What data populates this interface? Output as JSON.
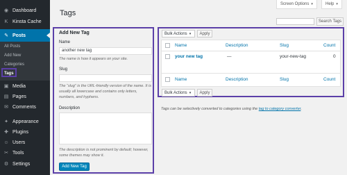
{
  "sidebar": {
    "items": [
      {
        "icon": "dashboard-icon",
        "glyph": "◉",
        "label": "Dashboard"
      },
      {
        "icon": "kinsta-icon",
        "glyph": "K",
        "label": "Kinsta Cache"
      },
      {
        "icon": "pin-icon",
        "glyph": "✎",
        "label": "Posts"
      },
      {
        "icon": "media-icon",
        "glyph": "▣",
        "label": "Media"
      },
      {
        "icon": "pages-icon",
        "glyph": "▤",
        "label": "Pages"
      },
      {
        "icon": "comments-icon",
        "glyph": "✉",
        "label": "Comments"
      },
      {
        "icon": "appearance-icon",
        "glyph": "✦",
        "label": "Appearance"
      },
      {
        "icon": "plugins-icon",
        "glyph": "✚",
        "label": "Plugins"
      },
      {
        "icon": "users-icon",
        "glyph": "☺",
        "label": "Users"
      },
      {
        "icon": "tools-icon",
        "glyph": "✂",
        "label": "Tools"
      },
      {
        "icon": "settings-icon",
        "glyph": "⚙",
        "label": "Settings"
      }
    ],
    "submenu": [
      "All Posts",
      "Add New",
      "Categories",
      "Tags"
    ]
  },
  "header": {
    "title": "Tags",
    "screen_options": "Screen Options",
    "help": "Help",
    "search_button": "Search Tags"
  },
  "add_form": {
    "title": "Add New Tag",
    "name_label": "Name",
    "name_value": "another new tag",
    "name_help": "The name is how it appears on your site.",
    "slug_label": "Slug",
    "slug_value": "",
    "slug_help": "The “slug” is the URL-friendly version of the name. It is usually all lowercase and contains only letters, numbers, and hyphens.",
    "description_label": "Description",
    "description_help": "The description is not prominent by default; however, some themes may show it.",
    "submit": "Add New Tag"
  },
  "table": {
    "bulk_actions": "Bulk Actions",
    "apply": "Apply",
    "columns": [
      "Name",
      "Description",
      "Slug",
      "Count"
    ],
    "rows": [
      {
        "name": "your new tag",
        "description": "—",
        "slug": "your-new-tag",
        "count": "0"
      }
    ]
  },
  "note": {
    "text": "Tags can be selectively converted to categories using the",
    "link": "tag to category converter",
    "end": "."
  }
}
